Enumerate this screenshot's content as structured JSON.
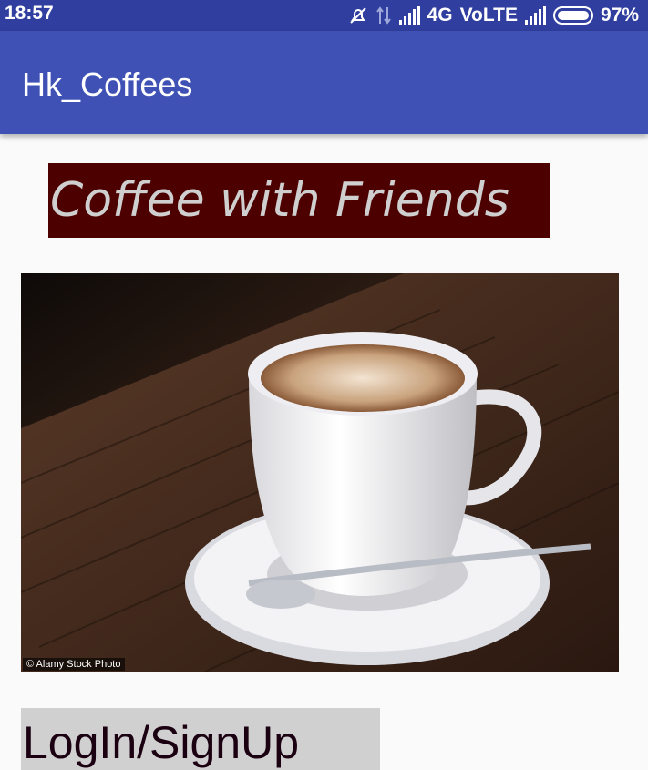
{
  "status_bar": {
    "time": "18:57",
    "network": "4G",
    "volte": "VoLTE",
    "battery": "97%",
    "icons": [
      "mute-icon",
      "data-arrows-icon",
      "signal-icon",
      "signal-icon",
      "battery-icon"
    ]
  },
  "app_bar": {
    "title": "Hk_Coffees",
    "color": "#3f51b5"
  },
  "tagline": {
    "text": "Coffee with Friends",
    "background": "#4d0000"
  },
  "photo": {
    "credit": "© Alamy Stock Photo",
    "subject": "coffee-cup-image"
  },
  "login_button": {
    "label": "LogIn/SignUp"
  }
}
